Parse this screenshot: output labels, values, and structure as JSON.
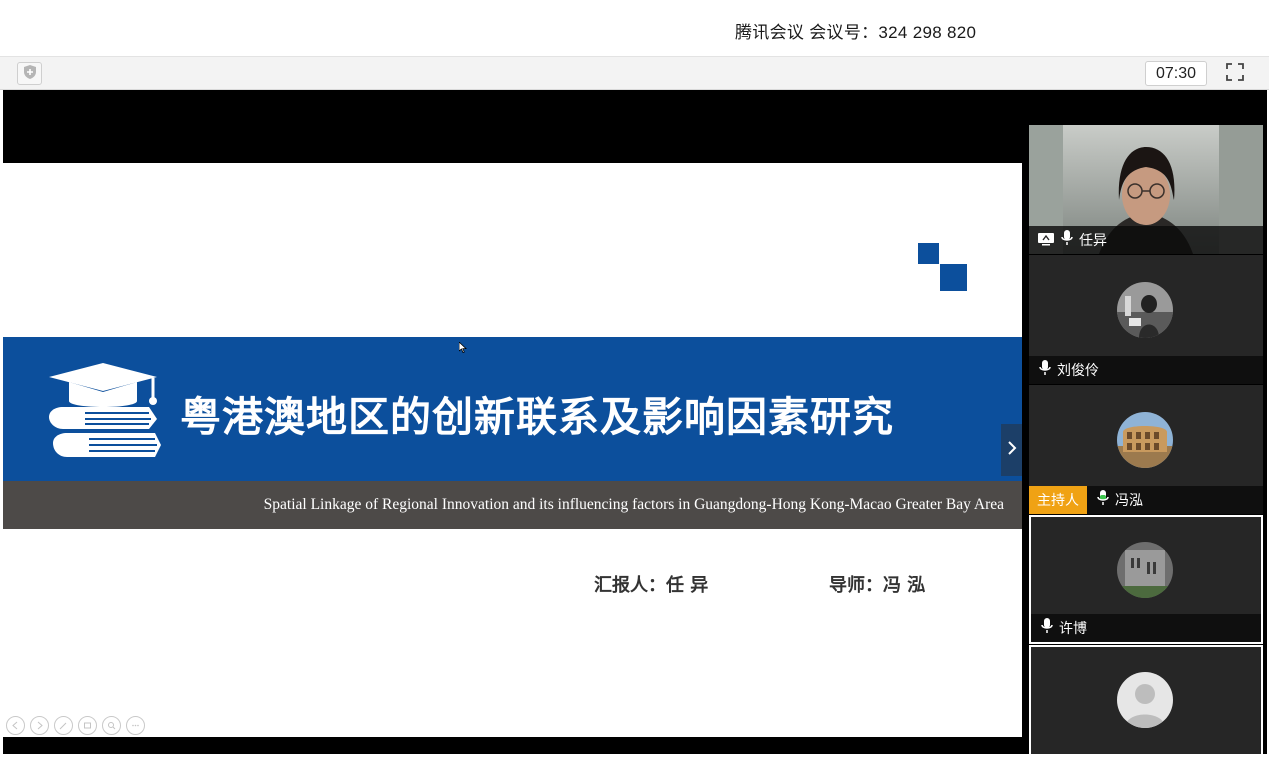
{
  "app": {
    "meeting_title": "腾讯会议 会议号：324 298 820",
    "timer": "07:30"
  },
  "slide": {
    "title": "粤港澳地区的创新联系及影响因素研究",
    "subtitle": "Spatial Linkage of Regional Innovation and its influencing factors in Guangdong-Hong Kong-Macao Greater Bay Area",
    "reporter": "汇报人：任 异",
    "advisor": "导师：冯 泓"
  },
  "participants": [
    {
      "name": "任异",
      "video": true,
      "sharing": true,
      "mic": "on"
    },
    {
      "name": "刘俊伶",
      "video": false,
      "mic": "on"
    },
    {
      "name": "冯泓",
      "video": false,
      "mic": "active",
      "badge": "主持人"
    },
    {
      "name": "许博",
      "video": false,
      "mic": "on",
      "selected": true
    },
    {
      "name": "",
      "video": false,
      "mic": "on",
      "selected": true
    }
  ],
  "colors": {
    "slide_blue": "#0c4f9c",
    "slide_gray": "#4d4a48",
    "host_badge": "#f0a214",
    "mic_active": "#3ec74f"
  }
}
